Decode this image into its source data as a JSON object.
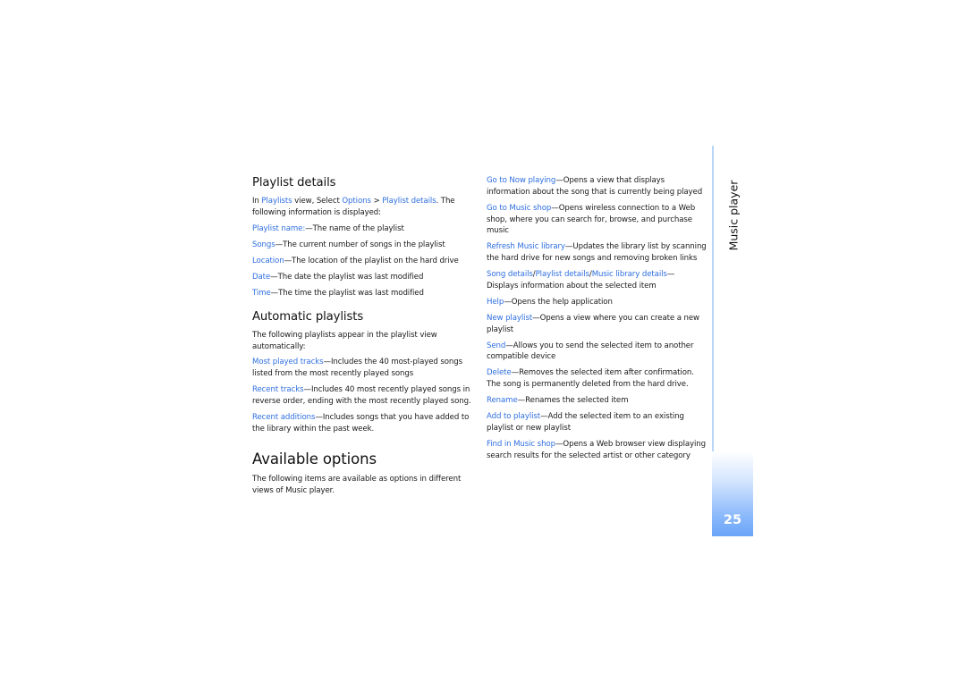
{
  "playlist_details": {
    "heading": "Playlist details",
    "intro": {
      "t1": "In ",
      "l1": "Playlists",
      "t2": " view, Select ",
      "l2": "Options",
      "t3": " > ",
      "l3": "Playlist details",
      "t4": ". The following information is displayed:"
    },
    "items": [
      {
        "term": "Playlist name:",
        "desc": "—The name of the playlist"
      },
      {
        "term": "Songs",
        "desc": "—The current number of songs in the playlist"
      },
      {
        "term": "Location",
        "desc": "—The location of the playlist on the hard drive"
      },
      {
        "term": "Date",
        "desc": "—The date the playlist was last modified"
      },
      {
        "term": "Time",
        "desc": "—The time the playlist was last modified"
      }
    ]
  },
  "automatic_playlists": {
    "heading": "Automatic playlists",
    "intro": "The following playlists appear in the playlist view automatically:",
    "items": [
      {
        "term": "Most played tracks",
        "desc": "—Includes the 40 most-played songs listed from the most recently played songs"
      },
      {
        "term": "Recent tracks",
        "desc": "—Includes 40 most recently played songs in reverse order, ending with the most recently played song."
      },
      {
        "term": "Recent additions",
        "desc": "—Includes songs that you have added to the library within the past week."
      }
    ]
  },
  "available_options": {
    "heading": "Available options",
    "intro": "The following items are available as options in different views of Music player.",
    "items": [
      {
        "term": "Go to Now playing",
        "desc": "—Opens a view that displays information about the song that is currently being played"
      },
      {
        "term": "Go to Music shop",
        "desc": "—Opens wireless connection to a Web shop, where you can search for, browse, and purchase music"
      },
      {
        "term": "Refresh Music library",
        "desc": "—Updates the library list by scanning the hard drive for new songs and removing broken links"
      },
      {
        "term_parts": [
          "Song details",
          "/",
          "Playlist details",
          "/",
          "Music library details"
        ],
        "desc": "— Displays information about the selected item"
      },
      {
        "term": "Help",
        "desc": "—Opens the help application"
      },
      {
        "term": "New playlist",
        "desc": "—Opens a view where you can create a new playlist"
      },
      {
        "term": "Send",
        "desc": "—Allows you to send the selected item to another compatible device"
      },
      {
        "term": "Delete",
        "desc": "—Removes the selected item after confirmation. The song is permanently deleted from the hard drive."
      },
      {
        "term": "Rename",
        "desc": "—Renames the selected item"
      },
      {
        "term": "Add to playlist",
        "desc": "—Add the selected item to an existing playlist or new playlist"
      },
      {
        "term": "Find in Music shop",
        "desc": "—Opens a Web browser view displaying search results for the selected artist or other category"
      }
    ]
  },
  "sidebar": {
    "section_label": "Music player",
    "page_number": "25"
  },
  "colors": {
    "link": "#2f6fe0",
    "tab_line": "#b8d6f6",
    "page_box_bottom": "#6aa4f8"
  }
}
